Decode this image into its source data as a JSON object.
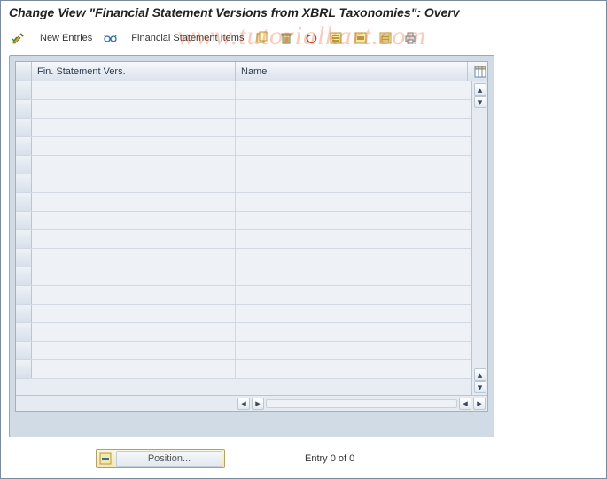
{
  "page_title": "Change View \"Financial Statement Versions from XBRL Taxonomies\": Overv",
  "watermark": "www.tutorialkart.com",
  "toolbar": {
    "new_entries_label": "New Entries",
    "fin_items_label": "Financial Statement Items",
    "icons": {
      "toggle": "toggle-icon",
      "glasses": "glasses-icon",
      "copy": "copy-icon",
      "delete": "delete-icon",
      "undo": "undo-icon",
      "select_all": "select-all-icon",
      "select_block": "select-block-icon",
      "deselect": "deselect-icon",
      "print": "print-icon"
    }
  },
  "grid": {
    "columns": {
      "fsv": "Fin. Statement Vers.",
      "name": "Name"
    },
    "row_count": 16
  },
  "footer": {
    "position_label": "Position...",
    "entry_text": "Entry 0 of 0"
  }
}
